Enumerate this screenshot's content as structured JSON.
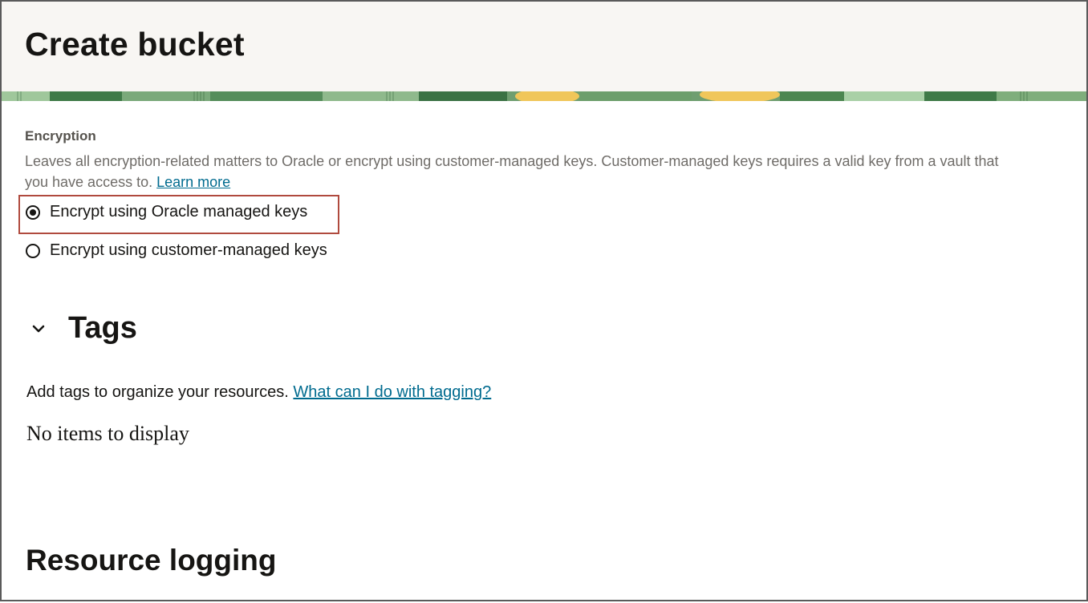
{
  "page": {
    "title": "Create bucket"
  },
  "encryption": {
    "label": "Encryption",
    "help_text": "Leaves all encryption-related matters to Oracle or encrypt using customer-managed keys. Customer-managed keys requires a valid key from a vault that you have access to.",
    "learn_more_link": "Learn more",
    "options": [
      {
        "label": "Encrypt using Oracle managed keys",
        "selected": true
      },
      {
        "label": "Encrypt using customer-managed keys",
        "selected": false
      }
    ]
  },
  "tags": {
    "title": "Tags",
    "expanded": true,
    "description": "Add tags to organize your resources.",
    "help_link": "What can I do with tagging?",
    "empty_message": "No items to display"
  },
  "resource_logging": {
    "title": "Resource logging"
  },
  "colors": {
    "link": "#006b8f",
    "highlight_border": "#b04a3e",
    "header_background": "#f8f6f3",
    "banner_green": "#4f8a55",
    "banner_accent": "#f0c65a"
  }
}
